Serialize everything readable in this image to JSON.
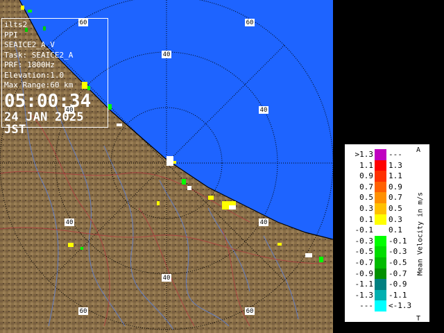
{
  "info": {
    "radar": "ilts2",
    "product": "PPI",
    "product_name": "SEAICE2_A_V",
    "task": "Task: SEAICE2_A",
    "prf": "PRF: 1800Hz",
    "elevation": "Elevation:1.0",
    "max_range": "Max Range:60 km",
    "time": "05:00:34",
    "date": "24 JAN 2025 JST"
  },
  "range_labels": {
    "ring_40": "40",
    "ring_60": "60"
  },
  "legend": {
    "unit": "Mean Velocity in m/s",
    "top_mark": "A",
    "bottom_mark": "T",
    "rows": [
      {
        "lo": ">1.3",
        "hi": "---",
        "color": "#c000c0"
      },
      {
        "lo": "1.1",
        "hi": "1.3",
        "color": "#ff0000"
      },
      {
        "lo": "0.9",
        "hi": "1.1",
        "color": "#ff3000"
      },
      {
        "lo": "0.7",
        "hi": "0.9",
        "color": "#ff6000"
      },
      {
        "lo": "0.5",
        "hi": "0.7",
        "color": "#ff9000"
      },
      {
        "lo": "0.3",
        "hi": "0.5",
        "color": "#ffc000"
      },
      {
        "lo": "0.1",
        "hi": "0.3",
        "color": "#ffff00"
      },
      {
        "lo": "-0.1",
        "hi": "0.1",
        "color": "#ffffff"
      },
      {
        "lo": "-0.3",
        "hi": "-0.1",
        "color": "#00ff00"
      },
      {
        "lo": "-0.5",
        "hi": "-0.3",
        "color": "#00dd00"
      },
      {
        "lo": "-0.7",
        "hi": "-0.5",
        "color": "#00bb00"
      },
      {
        "lo": "-0.9",
        "hi": "-0.7",
        "color": "#009000"
      },
      {
        "lo": "-1.1",
        "hi": "-0.9",
        "color": "#008080"
      },
      {
        "lo": "-1.3",
        "hi": "-1.1",
        "color": "#00b0b0"
      },
      {
        "lo": "---",
        "hi": "<-1.3",
        "color": "#00ffff"
      }
    ]
  },
  "colors": {
    "sea": "#1e64ff",
    "land": "#8a7048",
    "rivers": "#6080d0",
    "borders": "#b04040"
  }
}
